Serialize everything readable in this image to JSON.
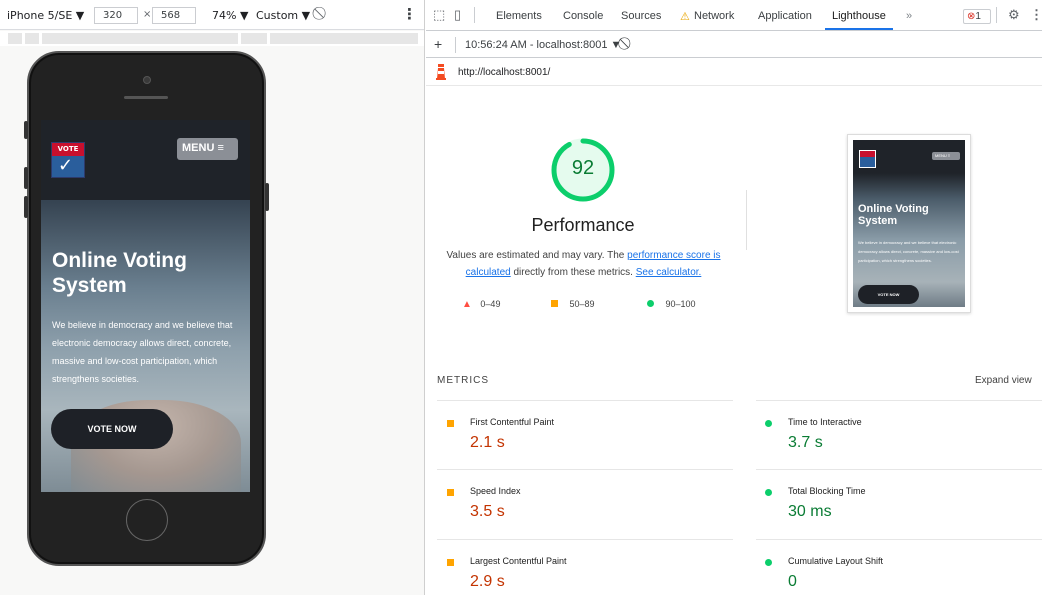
{
  "device_toolbar": {
    "device": "iPhone 5/SE ▼",
    "width": "320",
    "height": "568",
    "times": "×",
    "zoom": "74% ▼",
    "throttle": "Custom ▼",
    "rotate_icon": "rotate-icon",
    "more_icon": "kebab-icon"
  },
  "phone_page": {
    "logo_text": "VOTE",
    "menu_label": "MENU ≡",
    "hero_title": "Online Voting System",
    "hero_body": "We believe in democracy and we believe that electronic democracy allows direct, concrete, massive and low-cost participation, which strengthens societies.",
    "cta_label": "VOTE NOW"
  },
  "devtools": {
    "tabs": [
      {
        "label": "Elements"
      },
      {
        "label": "Console"
      },
      {
        "label": "Sources"
      },
      {
        "label": "Network",
        "warn": "⚠"
      },
      {
        "label": "Application"
      },
      {
        "label": "Lighthouse",
        "active": true
      }
    ],
    "overflow": "»",
    "error_badge": "1",
    "settings_icon": "gear-icon",
    "more_icon": "kebab-icon",
    "toolbar": {
      "add": "+",
      "report_selector": "10:56:24 AM - localhost:8001 ▼",
      "clear_icon": "clear-icon"
    },
    "url": "http://localhost:8001/"
  },
  "lighthouse": {
    "score": "92",
    "score_fraction": 0.92,
    "category_title": "Performance",
    "desc_1": "Values are estimated and may vary. The ",
    "desc_link_1": "performance score is calculated",
    "desc_2": " directly from these metrics. ",
    "desc_link_2": "See calculator.",
    "legend": [
      {
        "range": "0–49",
        "color": "#ff4e42",
        "shape": "triangle"
      },
      {
        "range": "50–89",
        "color": "#ffa400",
        "shape": "square"
      },
      {
        "range": "90–100",
        "color": "#0cce6b",
        "shape": "circle"
      }
    ],
    "thumbnail": {
      "menu_label": "MENU ≡",
      "title": "Online Voting System",
      "body": "We believe in democracy and we believe that electronic democracy allows direct, concrete, massive and low-cost participation, which strengthens societies.",
      "cta_label": "VOTE NOW"
    },
    "metrics_heading": "METRICS",
    "expand_label": "Expand view",
    "metrics": [
      {
        "label": "First Contentful Paint",
        "value": "2.1 s",
        "rating": "average"
      },
      {
        "label": "Time to Interactive",
        "value": "3.7 s",
        "rating": "good"
      },
      {
        "label": "Speed Index",
        "value": "3.5 s",
        "rating": "average"
      },
      {
        "label": "Total Blocking Time",
        "value": "30 ms",
        "rating": "good"
      },
      {
        "label": "Largest Contentful Paint",
        "value": "2.9 s",
        "rating": "average"
      },
      {
        "label": "Cumulative Layout Shift",
        "value": "0",
        "rating": "good"
      }
    ],
    "colors": {
      "good": "#0cce6b",
      "good_text": "#0a7c34",
      "average": "#ffa400",
      "average_text": "#c33300",
      "poor": "#ff4e42",
      "accent": "#1a73e8"
    }
  }
}
